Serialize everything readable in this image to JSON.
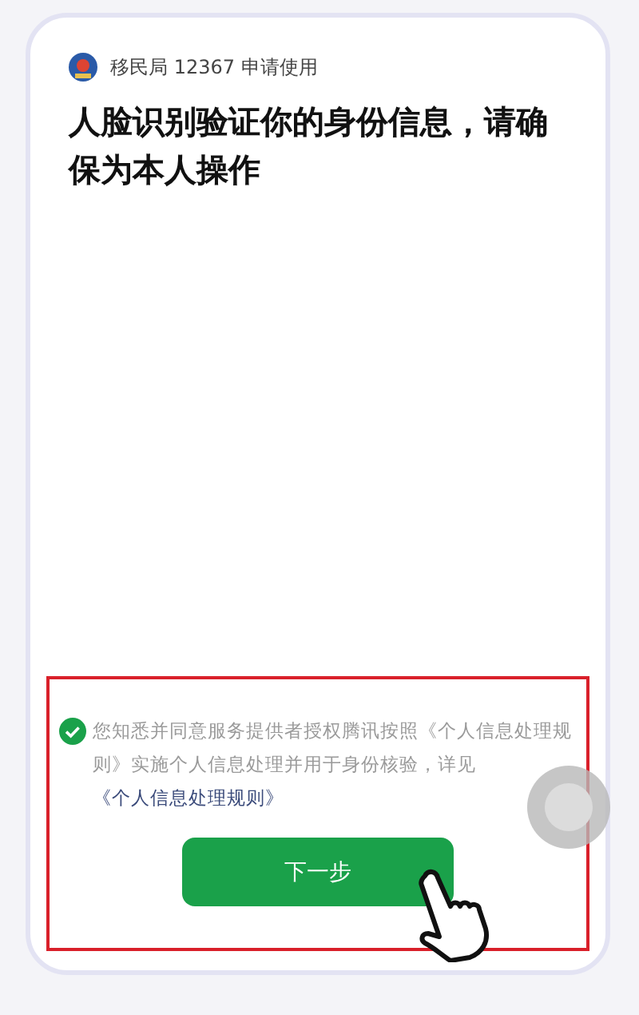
{
  "header": {
    "app_name": "移民局 12367 申请使用"
  },
  "title": "人脸识别验证你的身份信息，请确保为本人操作",
  "agreement": {
    "checked": true,
    "text_before": "您知悉并同意服务提供者授权腾讯按照《个人信息处理规则》实施个人信息处理并用于身份核验，详见",
    "link": "《个人信息处理规则》"
  },
  "button": {
    "label": "下一步"
  }
}
